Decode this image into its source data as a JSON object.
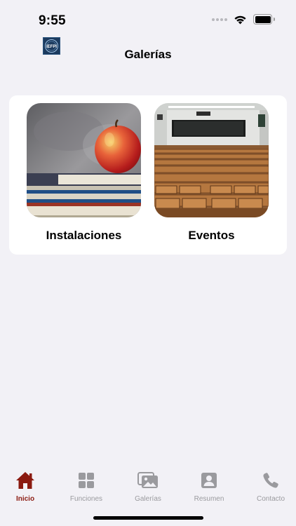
{
  "status_bar": {
    "time": "9:55",
    "icons": [
      "signal-dots-icon",
      "wifi-icon",
      "battery-icon"
    ]
  },
  "header": {
    "logo_text": "IEFPI",
    "title": "Galerías"
  },
  "galleries": [
    {
      "label": "Instalaciones",
      "image": "apple-on-books-photo"
    },
    {
      "label": "Eventos",
      "image": "lecture-hall-photo"
    }
  ],
  "tab_bar": {
    "items": [
      {
        "label": "Inicio",
        "icon": "house-icon",
        "active": true
      },
      {
        "label": "Funciones",
        "icon": "grid-icon",
        "active": false
      },
      {
        "label": "Galerías",
        "icon": "photos-icon",
        "active": false
      },
      {
        "label": "Resumen",
        "icon": "person-card-icon",
        "active": false
      },
      {
        "label": "Contacto",
        "icon": "phone-icon",
        "active": false
      }
    ]
  },
  "colors": {
    "accent": "#8b1a10",
    "inactive": "#9a9a9e",
    "background": "#f2f1f6"
  }
}
